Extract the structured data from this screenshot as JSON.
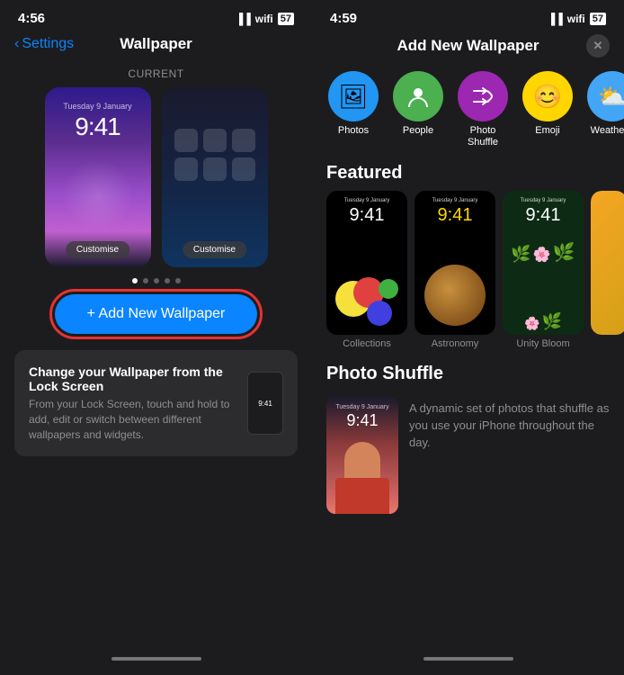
{
  "left": {
    "status_time": "4:56",
    "signal": "▐▐",
    "wifi": "wifi",
    "battery": "57",
    "back_label": "Settings",
    "title": "Wallpaper",
    "current_label": "CURRENT",
    "lock_time_small": "Tuesday 9 January",
    "lock_time_large": "9:41",
    "customise_lock": "Customise",
    "customise_home": "Customise",
    "add_btn_label": "+ Add New Wallpaper",
    "info_title": "Change your Wallpaper from the Lock Screen",
    "info_desc": "From your Lock Screen, touch and hold to add, edit or switch between different wallpapers and widgets.",
    "info_time": "9:41"
  },
  "right": {
    "status_time": "4:59",
    "modal_title": "Add New Wallpaper",
    "close_label": "✕",
    "types": [
      {
        "id": "photos",
        "emoji": "🖼",
        "label": "Photos",
        "color": "#2196f3"
      },
      {
        "id": "people",
        "emoji": "👤",
        "label": "People",
        "color": "#4caf50"
      },
      {
        "id": "shuffle",
        "emoji": "🔀",
        "label": "Photo\nShuffle",
        "color": "#9c27b0"
      },
      {
        "id": "emoji",
        "emoji": "😊",
        "label": "Emoji",
        "color": "#ffd600"
      },
      {
        "id": "weather",
        "emoji": "⛅",
        "label": "Weathe…",
        "color": "#42a5f5"
      }
    ],
    "featured_label": "Featured",
    "featured": [
      {
        "name": "Collections",
        "time_small": "Tuesday 9 January",
        "time_large": "9:41",
        "theme": "circles"
      },
      {
        "name": "Astronomy",
        "time_small": "Tuesday 9 January",
        "time_large": "9:41",
        "theme": "planet"
      },
      {
        "name": "Unity Bloom",
        "time_small": "Tuesday 9 January",
        "time_large": "9:41",
        "theme": "flowers"
      },
      {
        "name": "",
        "time_small": "",
        "time_large": "",
        "theme": "food"
      }
    ],
    "photo_shuffle_label": "Photo Shuffle",
    "shuffle_time_small": "Tuesday 9 January",
    "shuffle_time_large": "9:41",
    "shuffle_desc": "A dynamic set of photos that shuffle as you use your iPhone throughout the day."
  }
}
